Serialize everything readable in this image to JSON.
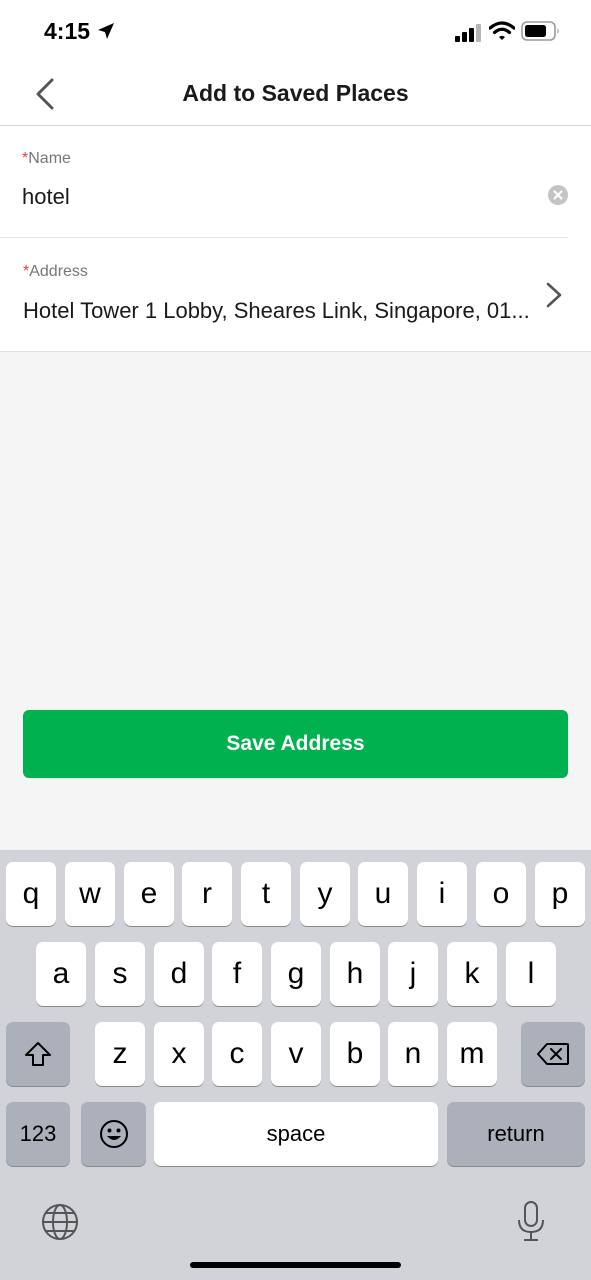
{
  "status_bar": {
    "time": "4:15",
    "icons": [
      "location-arrow-icon",
      "cellular-signal-icon",
      "wifi-icon",
      "battery-icon"
    ]
  },
  "nav": {
    "title": "Add to Saved Places",
    "back_icon": "chevron-left-icon"
  },
  "form": {
    "name": {
      "required_mark": "*",
      "label": "Name",
      "value": "hotel",
      "clear_icon": "clear-circle-icon"
    },
    "address": {
      "required_mark": "*",
      "label": "Address",
      "value": "Hotel Tower 1 Lobby, Sheares Link, Singapore, 01...",
      "chevron_icon": "chevron-right-icon"
    }
  },
  "save_button": {
    "label": "Save Address",
    "color": "#00b14f"
  },
  "keyboard": {
    "row1": [
      "q",
      "w",
      "e",
      "r",
      "t",
      "y",
      "u",
      "i",
      "o",
      "p"
    ],
    "row2": [
      "a",
      "s",
      "d",
      "f",
      "g",
      "h",
      "j",
      "k",
      "l"
    ],
    "row3": [
      "z",
      "x",
      "c",
      "v",
      "b",
      "n",
      "m"
    ],
    "numbers_label": "123",
    "space_label": "space",
    "return_label": "return",
    "icons": [
      "shift-icon",
      "backspace-icon",
      "emoji-icon",
      "globe-icon",
      "microphone-icon"
    ]
  }
}
